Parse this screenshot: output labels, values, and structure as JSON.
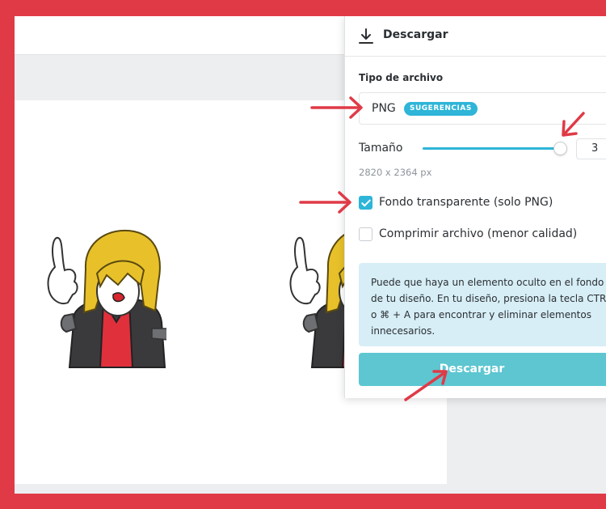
{
  "colors": {
    "frame": "#e03a47",
    "accent": "#2eb5d8",
    "button": "#5dc6d1",
    "notice_bg": "#d7eef6",
    "annotation_arrow": "#e03a47"
  },
  "panel": {
    "title": "Descargar",
    "icon": "download-icon",
    "file_type": {
      "label": "Tipo de archivo",
      "value": "PNG",
      "badge": "SUGERENCIAS"
    },
    "size": {
      "label": "Tamaño",
      "slider_fraction": 0.99,
      "input_value": "3",
      "dimensions": "2820 x 2364 px"
    },
    "options": [
      {
        "label": "Fondo transparente (solo PNG)",
        "checked": true
      },
      {
        "label": "Comprimir archivo (menor calidad)",
        "checked": false
      }
    ],
    "notice": {
      "lines": [
        "Puede que haya un elemento oculto en el fondo",
        "de tu diseño. En tu diseño, presiona la tecla CTRL",
        "o ⌘ + A para encontrar y eliminar elementos",
        "innecesarios."
      ]
    },
    "download_button": "Descargar"
  }
}
